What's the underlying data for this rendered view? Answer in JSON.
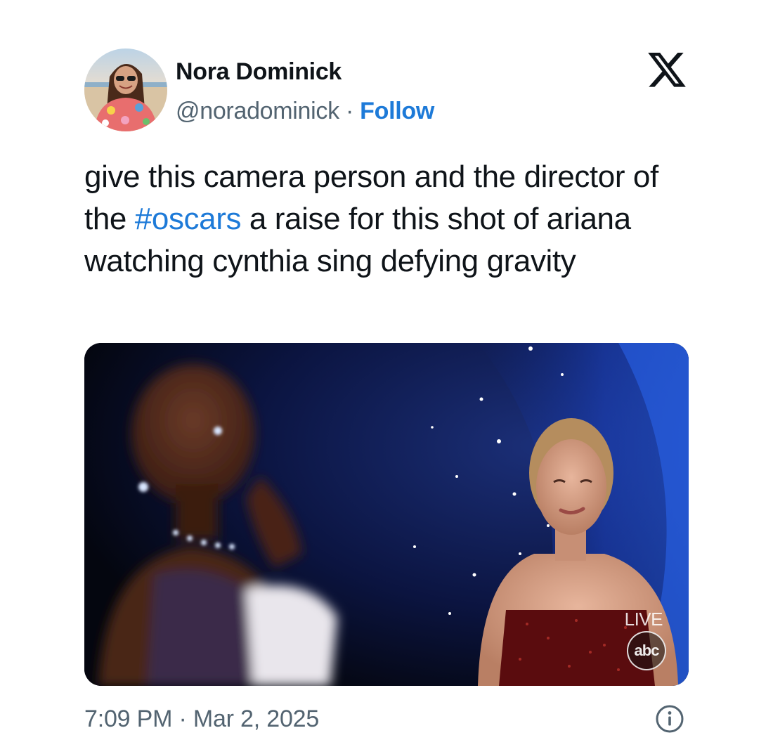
{
  "author": {
    "name": "Nora Dominick",
    "handle": "@noradominick",
    "separator": " · ",
    "follow_label": "Follow",
    "avatar_icon": "user-avatar-photo"
  },
  "brand": {
    "logo_icon": "x-logo-icon"
  },
  "tweet": {
    "text_before": "give this camera person and the director of the ",
    "hashtag": "#oscars",
    "text_after": " a raise for this shot of ariana watching cynthia sing defying gravity"
  },
  "media": {
    "type": "video-still",
    "live_label": "LIVE",
    "network_logo": "abc"
  },
  "footer": {
    "timestamp": "7:09 PM · Mar 2, 2025",
    "info_icon": "info-icon"
  },
  "colors": {
    "link": "#1d7ad8",
    "text": "#0f1419",
    "secondary": "#536471",
    "background": "#ffffff"
  }
}
